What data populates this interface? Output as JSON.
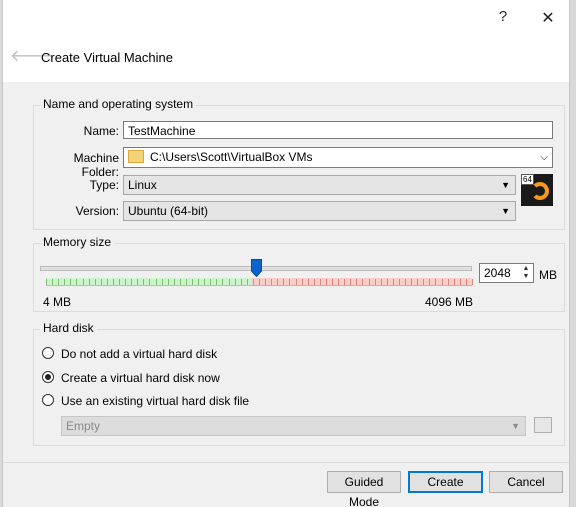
{
  "window": {
    "help_glyph": "?",
    "close_glyph": "✕"
  },
  "header": {
    "back_glyph": "🡐",
    "title": "Create Virtual Machine"
  },
  "name_os": {
    "group_title": "Name and operating system",
    "name_label": "Name:",
    "name_value": "TestMachine",
    "folder_label": "Machine Folder:",
    "folder_value": "C:\\Users\\Scott\\VirtualBox VMs",
    "type_label": "Type:",
    "type_value": "Linux",
    "version_label": "Version:",
    "version_value": "Ubuntu (64-bit)",
    "os_badge": "64",
    "os_icon": "ubuntu-64-icon"
  },
  "memory": {
    "group_title": "Memory size",
    "value": "2048",
    "unit": "MB",
    "min_label": "4 MB",
    "max_label": "4096 MB",
    "slider_fraction": 0.5,
    "green_color": "#cdf3cb",
    "red_color": "#f9cdc8",
    "handle_color": "#0b63ce"
  },
  "hard_disk": {
    "group_title": "Hard disk",
    "options": [
      {
        "label": "Do not add a virtual hard disk",
        "checked": false
      },
      {
        "label": "Create a virtual hard disk now",
        "checked": true
      },
      {
        "label": "Use an existing virtual hard disk file",
        "checked": false
      }
    ],
    "existing_value": "Empty"
  },
  "footer": {
    "guided_label": "Guided Mode",
    "create_label": "Create",
    "cancel_label": "Cancel"
  }
}
